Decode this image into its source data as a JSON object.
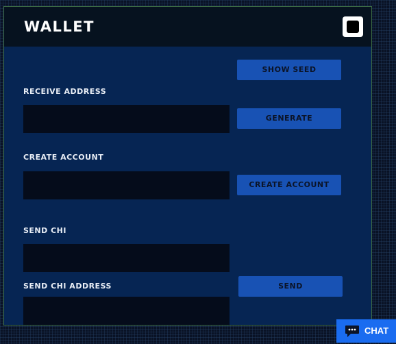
{
  "window": {
    "title": "WALLET",
    "close_icon": "window-control-icon"
  },
  "buttons": {
    "show_seed": "SHOW SEED",
    "generate": "GENERATE",
    "create_account": "CREATE ACCOUNT",
    "send": "SEND"
  },
  "fields": {
    "receive_address": {
      "label": "RECEIVE ADDRESS",
      "value": ""
    },
    "create_account": {
      "label": "CREATE ACCOUNT",
      "value": ""
    },
    "send_chi": {
      "label": "SEND CHI",
      "value": ""
    },
    "send_chi_address": {
      "label": "SEND CHI ADDRESS",
      "value": ""
    }
  },
  "chat": {
    "label": "CHAT",
    "icon": "chat-bubble-icon"
  },
  "colors": {
    "page_background": "#091225",
    "window_background": "#062553",
    "titlebar_background": "#06121f",
    "input_background": "#050c1b",
    "button_background": "#1852b4",
    "chat_background": "#1a6cf0",
    "window_border": "#3c6a44"
  }
}
